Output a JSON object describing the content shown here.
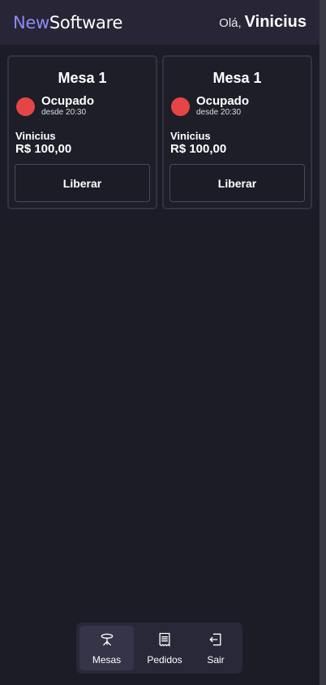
{
  "header": {
    "brand_new": "New",
    "brand_software": "Software",
    "greeting": "Olá,",
    "user_name": "Vinicius"
  },
  "tables": [
    {
      "title": "Mesa 1",
      "status": "Ocupado",
      "since": "desde 20:30",
      "client": "Vinicius",
      "amount": "R$ 100,00",
      "action": "Liberar",
      "status_color": "#e64545"
    },
    {
      "title": "Mesa 1",
      "status": "Ocupado",
      "since": "desde 20:30",
      "client": "Vinicius",
      "amount": "R$ 100,00",
      "action": "Liberar",
      "status_color": "#e64545"
    }
  ],
  "nav": {
    "items": [
      {
        "label": "Mesas",
        "icon": "table-icon",
        "active": true
      },
      {
        "label": "Pedidos",
        "icon": "receipt-icon",
        "active": false
      },
      {
        "label": "Sair",
        "icon": "logout-icon",
        "active": false
      }
    ]
  },
  "colors": {
    "accent": "#8b8cf3",
    "background": "#1c1c27",
    "header": "#272536",
    "occupied": "#e64545"
  }
}
